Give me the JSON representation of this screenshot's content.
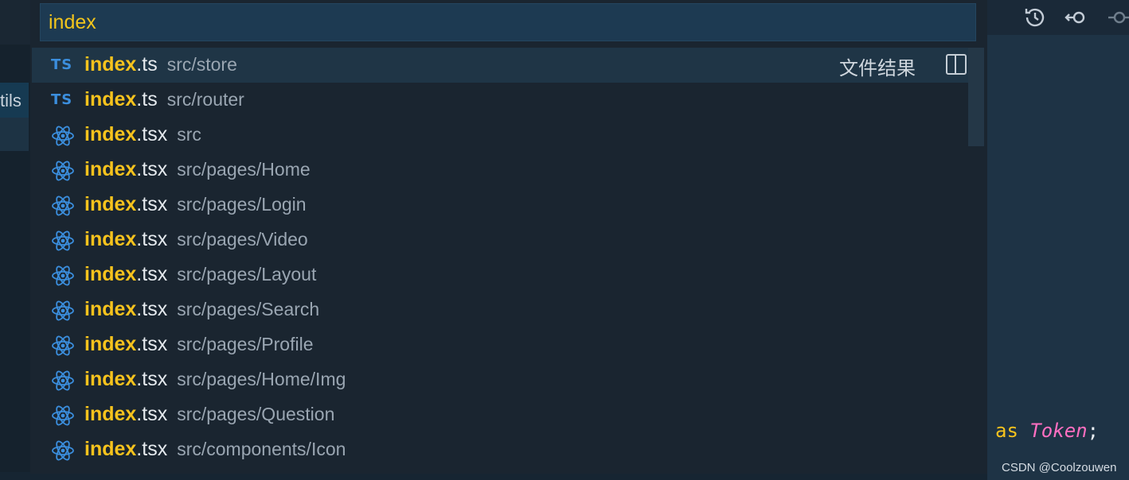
{
  "search": {
    "query": "index"
  },
  "results": [
    {
      "match": "index",
      "rest": ".ts",
      "path": "src/store",
      "icon": "typescript-icon",
      "icon_text": "TS"
    },
    {
      "match": "index",
      "rest": ".ts",
      "path": "src/router",
      "icon": "typescript-icon",
      "icon_text": "TS"
    },
    {
      "match": "index",
      "rest": ".tsx",
      "path": "src",
      "icon": "react-icon"
    },
    {
      "match": "index",
      "rest": ".tsx",
      "path": "src/pages/Home",
      "icon": "react-icon"
    },
    {
      "match": "index",
      "rest": ".tsx",
      "path": "src/pages/Login",
      "icon": "react-icon"
    },
    {
      "match": "index",
      "rest": ".tsx",
      "path": "src/pages/Video",
      "icon": "react-icon"
    },
    {
      "match": "index",
      "rest": ".tsx",
      "path": "src/pages/Layout",
      "icon": "react-icon"
    },
    {
      "match": "index",
      "rest": ".tsx",
      "path": "src/pages/Search",
      "icon": "react-icon"
    },
    {
      "match": "index",
      "rest": ".tsx",
      "path": "src/pages/Profile",
      "icon": "react-icon"
    },
    {
      "match": "index",
      "rest": ".tsx",
      "path": "src/pages/Home/Img",
      "icon": "react-icon"
    },
    {
      "match": "index",
      "rest": ".tsx",
      "path": "src/pages/Question",
      "icon": "react-icon"
    },
    {
      "match": "index",
      "rest": ".tsx",
      "path": "src/components/Icon",
      "icon": "react-icon"
    }
  ],
  "result_group_label": "文件结果",
  "sidebar": {
    "tab_label_fragment": "tils"
  },
  "editor": {
    "code_keyword": "as",
    "code_type": "Token",
    "code_semicolon": ";"
  },
  "toolbar": {
    "icons": [
      "history-icon",
      "back-circle-icon",
      "forward-circle-icon"
    ]
  },
  "watermark": "CSDN @Coolzouwen",
  "colors": {
    "match": "#f7c31d",
    "ts_icon": "#3b8edd",
    "react_icon": "#3b8edd",
    "selected_row": "#1f3546"
  }
}
